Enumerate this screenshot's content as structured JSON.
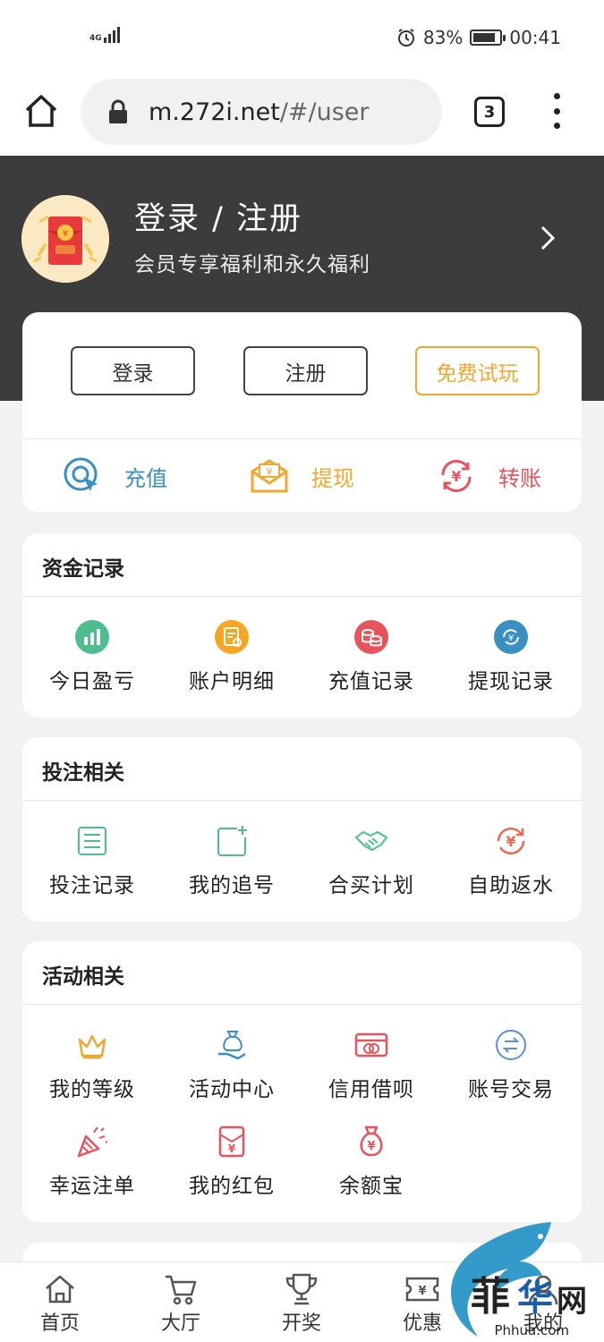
{
  "status_bar": {
    "network": "4G",
    "battery_percent": "83%",
    "battery_level": 0.83,
    "time": "00:41"
  },
  "browser": {
    "url_host": "m.272i.net",
    "url_path": "/#/user",
    "tab_count": "3"
  },
  "header": {
    "title": "登录 / 注册",
    "subtitle": "会员专享福利和永久福利"
  },
  "auth": {
    "login_label": "登录",
    "register_label": "注册",
    "trial_label": "免费试玩"
  },
  "quick_actions": [
    {
      "label": "充值",
      "color": "#3a8fc2"
    },
    {
      "label": "提现",
      "color": "#f0a830"
    },
    {
      "label": "转账",
      "color": "#e8545c"
    }
  ],
  "funds": {
    "title": "资金记录",
    "items": [
      {
        "label": "今日盈亏",
        "icon": "bar-chart-icon",
        "color": "#4dbf8f"
      },
      {
        "label": "账户明细",
        "icon": "document-icon",
        "color": "#f5a623"
      },
      {
        "label": "充值记录",
        "icon": "coins-icon",
        "color": "#e8545c"
      },
      {
        "label": "提现记录",
        "icon": "yuan-refresh-icon",
        "color": "#3a8fc2"
      }
    ]
  },
  "betting": {
    "title": "投注相关",
    "items": [
      {
        "label": "投注记录",
        "icon": "list-icon"
      },
      {
        "label": "我的追号",
        "icon": "add-square-icon"
      },
      {
        "label": "合买计划",
        "icon": "handshake-icon"
      },
      {
        "label": "自助返水",
        "icon": "yuan-cycle-icon"
      }
    ]
  },
  "activities": {
    "title": "活动相关",
    "items": [
      {
        "label": "我的等级",
        "icon": "crown-icon"
      },
      {
        "label": "活动中心",
        "icon": "money-bag-hand-icon"
      },
      {
        "label": "信用借呗",
        "icon": "card-icon"
      },
      {
        "label": "账号交易",
        "icon": "exchange-icon"
      },
      {
        "label": "幸运注单",
        "icon": "party-popper-icon"
      },
      {
        "label": "我的红包",
        "icon": "red-envelope-icon"
      },
      {
        "label": "余额宝",
        "icon": "money-bag-icon"
      }
    ]
  },
  "bottom_nav": [
    {
      "label": "首页",
      "icon": "home-icon"
    },
    {
      "label": "大厅",
      "icon": "cart-icon"
    },
    {
      "label": "开奖",
      "icon": "trophy-icon"
    },
    {
      "label": "优惠",
      "icon": "ticket-icon"
    },
    {
      "label": "我的",
      "icon": "user-icon"
    }
  ],
  "watermark": {
    "text": "Phhua.com"
  }
}
